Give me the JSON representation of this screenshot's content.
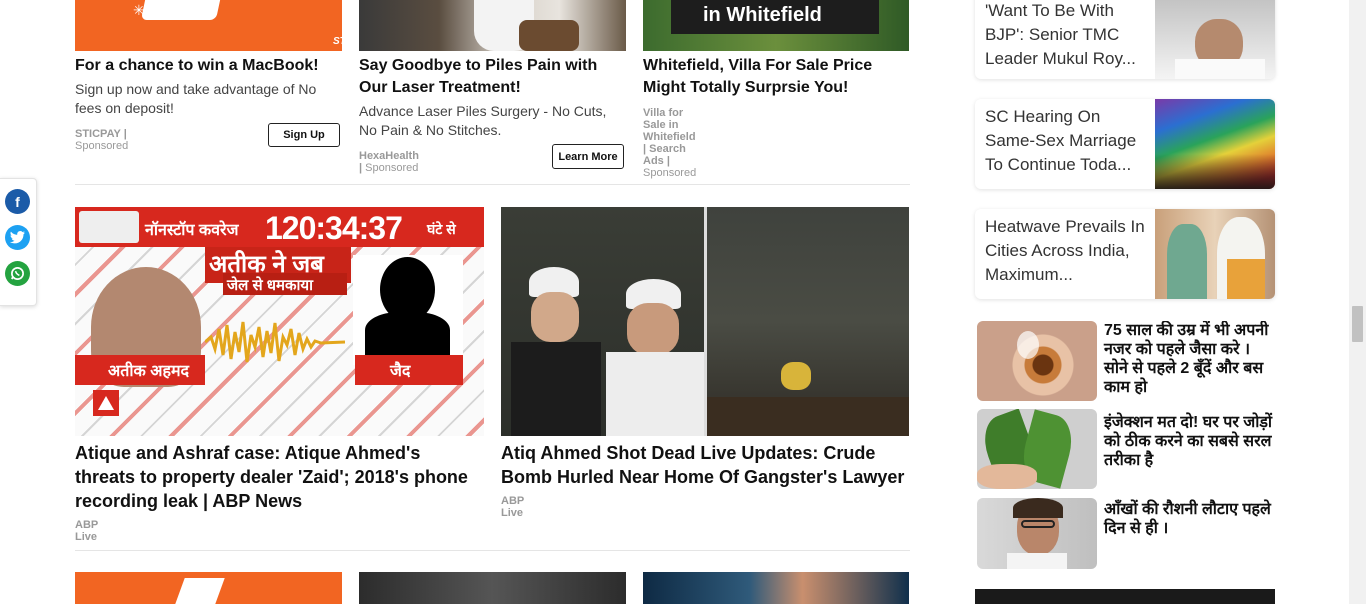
{
  "share": {
    "facebook": "f",
    "twitter": "t",
    "whatsapp": "w"
  },
  "ads": [
    {
      "title": "For a chance to win a MacBook!",
      "desc": "Sign up now and take advantage of No fees on deposit!",
      "source": "STICPAY",
      "sponsored": "Sponsored",
      "cta": "Sign Up",
      "brand": "STICPAY"
    },
    {
      "title": "Say Goodbye to Piles Pain with Our Laser Treatment!",
      "desc": "Advance Laser Piles Surgery - No Cuts, No Pain & No Stitches.",
      "source": "HexaHealth",
      "sponsored": "Sponsored",
      "cta": "Learn More"
    },
    {
      "title": "Whitefield, Villa For Sale Price Might Totally Surprsie You!",
      "source": "Villa for Sale in Whitefield | Search Ads",
      "sponsored": "Sponsored",
      "overlay": "in Whitefield"
    }
  ],
  "news": [
    {
      "title": "Atique and Ashraf case: Atique Ahmed's threats to property dealer 'Zaid'; 2018's phone recording leak | ABP News",
      "source": "ABP Live",
      "thumb": {
        "banner": "नॉनस्टॉप कवरेज",
        "timer": "120:34:37",
        "timer_suffix": "घंटे से",
        "headline1": "अतीक ने जब",
        "headline2": "जेल से धमकाया",
        "left_name": "अतीक अहमद",
        "right_name": "जैद"
      }
    },
    {
      "title": "Atiq Ahmed Shot Dead Live Updates: Crude Bomb Hurled Near Home Of Gangster's Lawyer",
      "source": "ABP Live"
    }
  ],
  "sidebar": [
    {
      "title": "'Want To Be With BJP': Senior TMC Leader Mukul Roy..."
    },
    {
      "title": "SC Hearing On Same-Sex Marriage To Continue Toda..."
    },
    {
      "title": "Heatwave Prevails In Cities Across India, Maximum..."
    }
  ],
  "hindi_ads": [
    {
      "title": "75 साल की उम्र में भी अपनी नजर को पहले जैसा करे । सोने से पहले 2 बूँदें और बस काम हो"
    },
    {
      "title": "इंजेक्शन मत दो! घर पर जोड़ों को ठीक करने का सबसे सरल तरीका है"
    },
    {
      "title": "आँखों की रौशनी लौटाए पहले दिन से ही ।"
    }
  ],
  "colors": {
    "accent": "#f26522",
    "facebook": "#1b5ba8",
    "twitter": "#1da1f2",
    "whatsapp": "#24a340"
  }
}
